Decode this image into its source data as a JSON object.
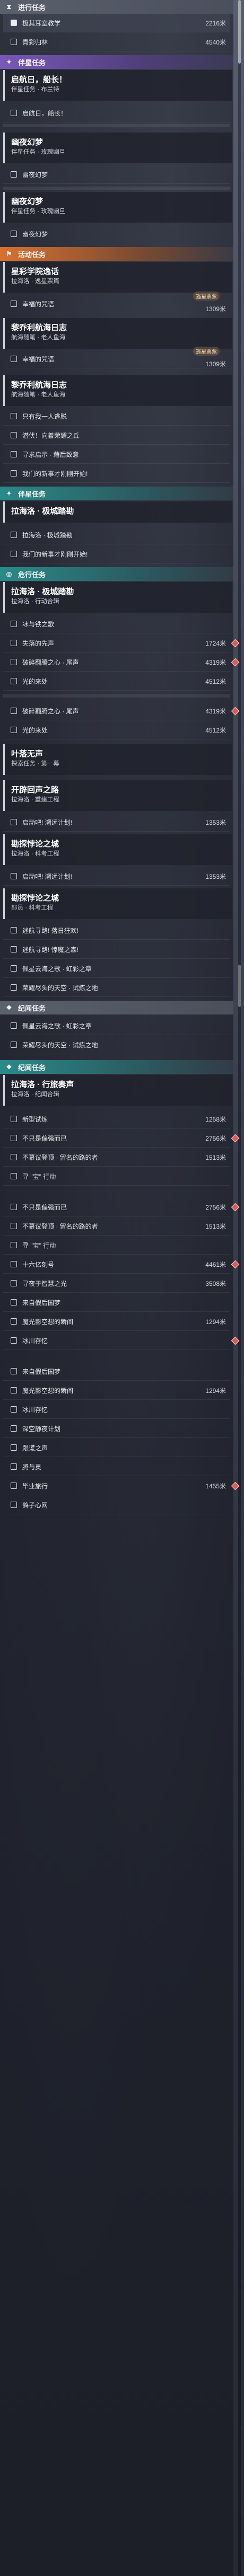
{
  "sections": {
    "ongoing": "进行任务",
    "companion": "伴星任务",
    "event": "活动任务",
    "companion2": "伴星任务",
    "daily": "危行任务",
    "record": "纪闻任务",
    "record2": "纪闻任务"
  },
  "top": {
    "row1": "极其耳室教学",
    "row1_val": "2216米",
    "row2": "青彩归林",
    "row2_val": "4540米"
  },
  "cards": {
    "c1_title": "启航日，船长！",
    "c1_sub": "伴星任务 · 布兰特",
    "c1_row": "启航日，船长！",
    "c2_title": "幽夜幻梦",
    "c2_sub": "伴星任务 · 玫瑰幽旦",
    "c2_row": "幽夜幻梦",
    "c3_title": "幽夜幻梦",
    "c3_sub": "伴星任务 · 玫瑰幽旦",
    "c3_row": "幽夜幻梦",
    "c4_title": "星彩学院逸话",
    "c4_sub": "拉海洛 · 逸星票篇",
    "c4_row": "幸福的咒语",
    "c4_val": "1309米",
    "c4_badge": "逃星票票",
    "c5_title": "黎乔利航海日志",
    "c5_sub": "航海随笔 · 老人鱼海",
    "c5_row": "幸福的咒语",
    "c5_val": "1309米",
    "c5_badge": "逃星票票",
    "c6_title": "黎乔利航海日志",
    "c6_sub": "航海随笔 · 老人鱼海",
    "c6_rows": [
      "只有我一人逃脱",
      "潜伏！向着荣耀之丘",
      "寻求启示 · 藉后致意",
      "我们的新事才刚刚开始!"
    ],
    "c7_title": "拉海洛 · 极城踏勘",
    "c7_sub": "拉海洛 · 极城踏勘",
    "c7_row": "我们的新事才刚刚开始!",
    "c8_title": "拉海洛 · 极城踏勘",
    "c8_sub": "拉海洛 · 行动合辑",
    "c8_rows": [
      {
        "t": "冰与铁之歌",
        "v": ""
      },
      {
        "t": "失落的先声",
        "v": "1724米"
      },
      {
        "t": "破碎翻腾之心 · 尾声",
        "v": "4319米"
      },
      {
        "t": "光的来处",
        "v": "4512米"
      }
    ],
    "c8_tail": [
      {
        "t": "破碎翻腾之心 · 尾声",
        "v": "4319米"
      },
      {
        "t": "光的来处",
        "v": "4512米"
      }
    ],
    "c9_title": "叶落无声",
    "c9_sub": "探索任务 · 第一幕",
    "c10_title": "开辟回声之路",
    "c10_sub": "拉海洛 · 重建工程",
    "c10_row": "启动吧! 溯远计划!",
    "c10_val": "1353米",
    "c11_title": "勘探悖论之城",
    "c11_sub": "拉海洛 · 科考工程",
    "c11_row": "启动吧! 溯远计划!",
    "c11_val": "1353米",
    "c12_title": "勘探悖论之城",
    "c12_sub": "部员 · 科考工程",
    "c12_rows": [
      "迷航寻路! 落日狂欢!",
      "迷航寻路! 惊魔之森!",
      "佩星云海之歌 · 虹彩之章",
      "荣耀尽头的天空 · 试炼之地"
    ],
    "c13_rows": [
      "佩星云海之歌 · 虹彩之章",
      "荣耀尽头的天空 · 试炼之地"
    ],
    "c14_title": "拉海洛 · 行旅奏声",
    "c14_sub": "拉海洛 · 纪闻合辑",
    "c14_rows": [
      {
        "t": "新型试炼",
        "v": "1258米"
      },
      {
        "t": "不只是偏强而已",
        "v": "2756米"
      },
      {
        "t": "不慕议登顶 · 留名的路的者",
        "v": "1513米"
      },
      {
        "t": "寻 \"宝\" 行动",
        "v": ""
      },
      {
        "t": "不只是偏强而已",
        "v": "2756米"
      },
      {
        "t": "不慕议登顶 · 留名的路的者",
        "v": "1513米"
      },
      {
        "t": "寻 \"宝\" 行动",
        "v": ""
      },
      {
        "t": "十六亿刻号",
        "v": "4461米"
      },
      {
        "t": "寻夜于智慧之光",
        "v": "3508米"
      },
      {
        "t": "来自假后国梦",
        "v": ""
      },
      {
        "t": "魔光影空想的瞬间",
        "v": "1294米"
      },
      {
        "t": "冰川存忆",
        "v": ""
      },
      {
        "t": "来自假后国梦",
        "v": ""
      },
      {
        "t": "魔光影空想的瞬间",
        "v": "1294米"
      },
      {
        "t": "冰川存忆",
        "v": ""
      },
      {
        "t": "深空静夜计划",
        "v": ""
      },
      {
        "t": "跟谎之声",
        "v": ""
      },
      {
        "t": "腾与灵",
        "v": ""
      },
      {
        "t": "毕业旅行",
        "v": "1455米"
      },
      {
        "t": "鸽子心网",
        "v": ""
      }
    ]
  },
  "colors": {
    "purple": "#7a58b8",
    "orange": "#d77230",
    "teal": "#2a8a8a",
    "mark": "#d85a5a"
  }
}
